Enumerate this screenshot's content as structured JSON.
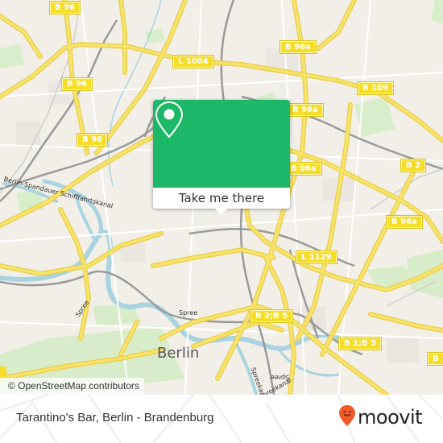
{
  "map": {
    "road_labels": [
      {
        "id": "b96-top",
        "text": "B 96"
      },
      {
        "id": "l1004",
        "text": "L 1004"
      },
      {
        "id": "b96-mid",
        "text": "B 96"
      },
      {
        "id": "b96-low",
        "text": "B 96"
      },
      {
        "id": "b96a-top",
        "text": "B 96a"
      },
      {
        "id": "b109",
        "text": "B 109"
      },
      {
        "id": "b96a-mid",
        "text": "B 96a"
      },
      {
        "id": "b96a-mid2",
        "text": "B 96a"
      },
      {
        "id": "b2",
        "text": "B 2"
      },
      {
        "id": "b96a-right",
        "text": "B 96a"
      },
      {
        "id": "l1129",
        "text": "L 1129"
      },
      {
        "id": "b2b5",
        "text": "B 2;B 5"
      },
      {
        "id": "b1b5",
        "text": "B 1;B 5"
      },
      {
        "id": "b-right-edge",
        "text": "B"
      }
    ],
    "water_labels": [
      {
        "id": "spandauer-kanal",
        "text": "Berlin-Spandauer Schifffahrtskanal"
      },
      {
        "id": "spree-1",
        "text": "Spree"
      },
      {
        "id": "spree-2",
        "text": "Spree"
      },
      {
        "id": "spree-3",
        "text": "Spree"
      },
      {
        "id": "spreekanal-1",
        "text": "Spreekanal"
      },
      {
        "id": "spreekanal-2",
        "text": "Spreekanal"
      }
    ],
    "city_label": "Berlin",
    "attribution": "© OpenStreetMap contributors"
  },
  "popup": {
    "icon": "map-pin-icon",
    "button_label": "Take me there",
    "color": "#1cb767"
  },
  "footer": {
    "place_name": "Tarantino's Bar, Berlin - Brandenburg",
    "brand": "moovit",
    "brand_color": "#f05a28"
  }
}
